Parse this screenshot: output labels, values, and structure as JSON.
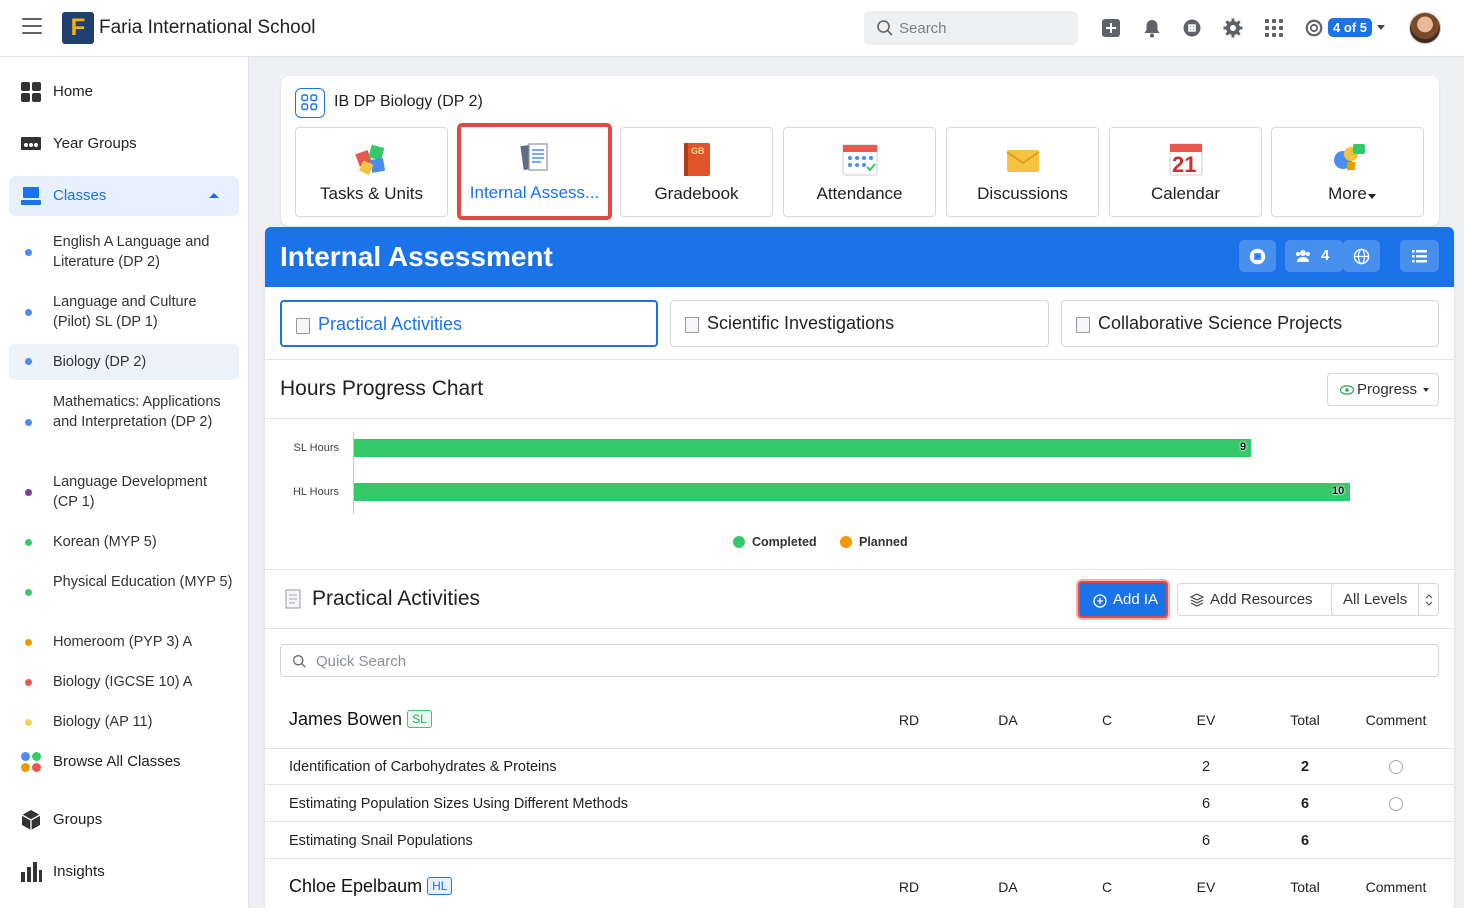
{
  "topbar": {
    "school_name": "Faria International School",
    "logo_letter": "F",
    "search_placeholder": "Search",
    "account_count": "4 of 5"
  },
  "sidebar": {
    "home": "Home",
    "year_groups": "Year Groups",
    "classes": "Classes",
    "class_items": [
      {
        "label": "English A Language and Literature (DP 2)",
        "color": "#4a8df0"
      },
      {
        "label": "Language and Culture (Pilot) SL (DP 1)",
        "color": "#4a8df0"
      },
      {
        "label": "Biology (DP 2)",
        "color": "#4a8df0"
      },
      {
        "label": "Mathematics: Applications and Interpretation (DP 2)",
        "color": "#4a8df0"
      },
      {
        "label": "Language Development (CP 1)",
        "color": "#7b3fa0"
      },
      {
        "label": "Korean (MYP 5)",
        "color": "#35c96a"
      },
      {
        "label": "Physical Education (MYP 5)",
        "color": "#35c96a"
      },
      {
        "label": "Homeroom (PYP 3) A",
        "color": "#f29900"
      },
      {
        "label": "Biology (IGCSE 10) A",
        "color": "#e8584f"
      },
      {
        "label": "Biology (AP 11)",
        "color": "#f5d35a"
      }
    ],
    "browse_all": "Browse All Classes",
    "groups": "Groups",
    "insights": "Insights"
  },
  "class_header": {
    "title": "IB DP Biology (DP 2)",
    "tiles": [
      "Tasks & Units",
      "Internal Assess...",
      "Gradebook",
      "Attendance",
      "Discussions",
      "Calendar",
      "More"
    ],
    "calendar_day": "21",
    "gradebook_badge": "GB"
  },
  "panel": {
    "title": "Internal Assessment",
    "members_count": "4",
    "tabs": [
      "Practical Activities",
      "Scientific Investigations",
      "Collaborative Science Projects"
    ],
    "chart_title": "Hours Progress Chart",
    "progress_btn": "Progress",
    "section_title": "Practical Activities",
    "add_ia": "Add IA",
    "add_resources": "Add Resources",
    "levels": "All Levels",
    "quick_search": "Quick Search"
  },
  "chart_data": {
    "type": "bar",
    "orientation": "horizontal",
    "categories": [
      "SL Hours",
      "HL Hours"
    ],
    "series": [
      {
        "name": "Completed",
        "color": "#35c96a",
        "values": [
          9,
          10
        ]
      },
      {
        "name": "Planned",
        "color": "#f29900",
        "values": [
          0,
          0
        ]
      }
    ],
    "xlim": [
      0,
      10.5
    ]
  },
  "table": {
    "columns": [
      "RD",
      "DA",
      "C",
      "EV",
      "Total",
      "Comment"
    ],
    "students": [
      {
        "name": "James Bowen",
        "level": "SL",
        "rows": [
          {
            "label": "Identification of Carbohydrates & Proteins",
            "ev": "2",
            "total": "2"
          },
          {
            "label": "Estimating Population Sizes Using Different Methods",
            "ev": "6",
            "total": "6"
          },
          {
            "label": "Estimating Snail Populations",
            "ev": "6",
            "total": "6"
          }
        ]
      },
      {
        "name": "Chloe Epelbaum",
        "level": "HL",
        "rows": []
      }
    ]
  }
}
